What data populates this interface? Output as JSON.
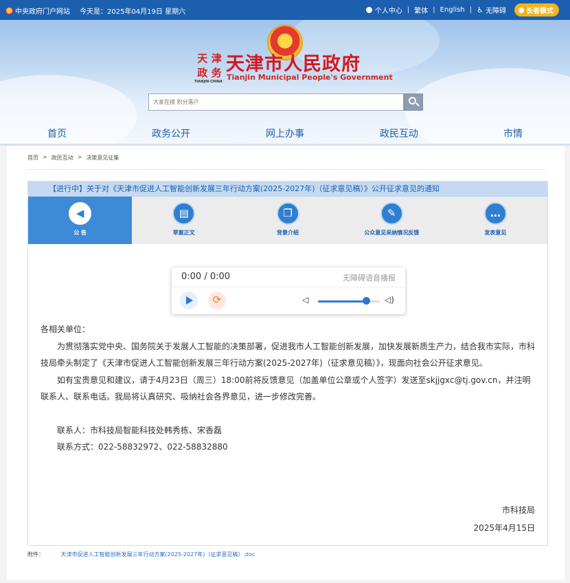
{
  "topbar": {
    "portal_link": "中央政府门户网站",
    "date_text": "今天是：2025年04月19日 星期六",
    "personal_center": "个人中心",
    "traditional": "繁体",
    "english": "English",
    "accessibility": "无障碍",
    "elder_mode": "长者模式",
    "separator": "|"
  },
  "header": {
    "logo_chars": [
      "天",
      "津",
      "政",
      "务"
    ],
    "logo_caption": "TIANJIN·CHINA",
    "title": "天津市人民政府",
    "subtitle": "Tianjin Municipal People's Government",
    "search_placeholder": "大家在搜 积分落户"
  },
  "nav": {
    "items": [
      "首页",
      "政务公开",
      "网上办事",
      "政民互动",
      "市情"
    ]
  },
  "breadcrumb": {
    "items": [
      "首页",
      "政民互动",
      "决策意见征集"
    ],
    "arrow": ">"
  },
  "notice": {
    "title": "【进行中】关于对《天津市促进人工智能创新发展三年行动方案(2025-2027年)（征求意见稿）》公开征求意见的通知",
    "tabs": [
      {
        "label": "公 告",
        "icon": "speaker-icon",
        "glyph": "◀"
      },
      {
        "label": "草案正文",
        "icon": "document-icon",
        "glyph": "▤"
      },
      {
        "label": "背景介绍",
        "icon": "copy-icon",
        "glyph": "❐"
      },
      {
        "label": "公众意见采纳情况反馈",
        "icon": "pen-icon",
        "glyph": "✎"
      },
      {
        "label": "发表意见",
        "icon": "chat-icon",
        "glyph": "…"
      }
    ],
    "active_tab": 0
  },
  "player": {
    "time": "0:00 / 0:00",
    "label": "无障碍语音播报",
    "volume_level": 0.78,
    "loop_glyph": "⟳",
    "volume_low_glyph": "◁",
    "volume_high_glyph": "◁)"
  },
  "body": {
    "salutation": "各相关单位：",
    "paragraph_1": "为贯彻落实党中央、国务院关于发展人工智能的决策部署，促进我市人工智能创新发展，加快发展新质生产力，结合我市实际，市科技局牵头制定了《天津市促进人工智能创新发展三年行动方案(2025-2027年)（征求意见稿）》，现面向社会公开征求意见。",
    "paragraph_2": "如有宝贵意见和建议，请于4月23日（周三）18:00前将反馈意见（加盖单位公章或个人签字）发送至skjjgxc@tj.gov.cn，并注明联系人、联系电话。我局将认真研究、吸纳社会各界意见，进一步修改完善。",
    "contact_person": "联系人：市科技局智能科技处韩秀栋、宋香磊",
    "contact_phone": "联系方式：022-58832972、022-58832880",
    "signer": "市科技局",
    "sign_date": "2025年4月15日"
  },
  "attachment": {
    "label": "附件：",
    "file": "天津市促进人工智能创新发展三年行动方案(2025-2027年)（征求意见稿）.doc"
  },
  "colors": {
    "topbar": "#1c5fae",
    "title_red": "#d3191d",
    "nav_blue": "#1d5eae",
    "active_tab": "#3d8ad6",
    "elder_button": "#f3b51c"
  }
}
